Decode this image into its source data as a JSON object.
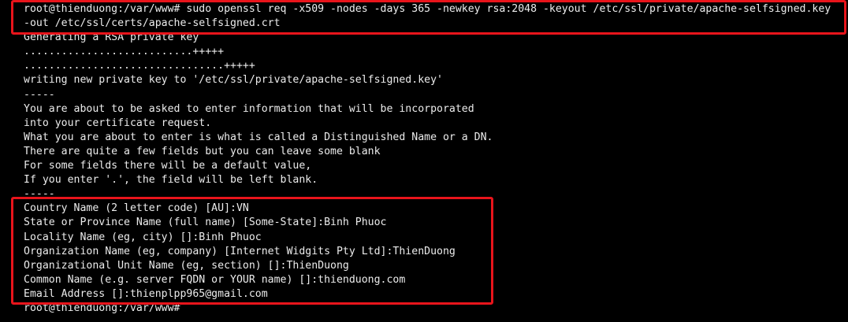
{
  "terminal": {
    "lines": [
      "root@thienduong:/var/www# sudo openssl req -x509 -nodes -days 365 -newkey rsa:2048 -keyout /etc/ssl/private/apache-selfsigned.key",
      "-out /etc/ssl/certs/apache-selfsigned.crt",
      "Generating a RSA private key",
      "...........................+++++",
      "................................+++++",
      "writing new private key to '/etc/ssl/private/apache-selfsigned.key'",
      "-----",
      "You are about to be asked to enter information that will be incorporated",
      "into your certificate request.",
      "What you are about to enter is what is called a Distinguished Name or a DN.",
      "There are quite a few fields but you can leave some blank",
      "For some fields there will be a default value,",
      "If you enter '.', the field will be left blank.",
      "-----",
      "Country Name (2 letter code) [AU]:VN",
      "State or Province Name (full name) [Some-State]:Binh Phuoc",
      "Locality Name (eg, city) []:Binh Phuoc",
      "Organization Name (eg, company) [Internet Widgits Pty Ltd]:ThienDuong",
      "Organizational Unit Name (eg, section) []:ThienDuong",
      "Common Name (e.g. server FQDN or YOUR name) []:thienduong.com",
      "Email Address []:thienplpp965@gmail.com",
      "root@thienduong:/var/www#"
    ]
  },
  "colors": {
    "background": "#000000",
    "text": "#ececec",
    "highlight": "#e8141b"
  }
}
